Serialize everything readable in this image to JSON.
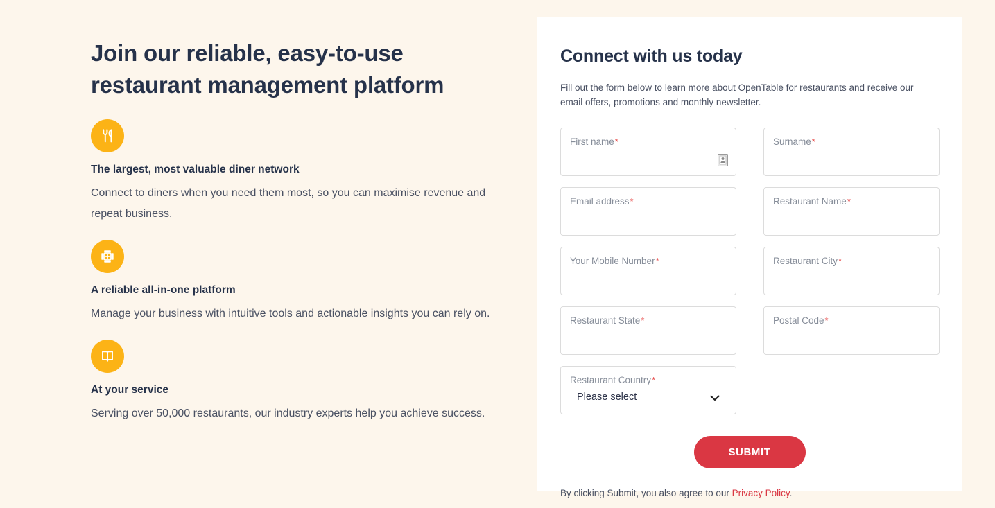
{
  "theme": {
    "page_background": "#fdf6ec",
    "panel_background": "#ffffff",
    "accent_amber": "#fcb316",
    "accent_red": "#da3743",
    "heading_color": "#26324a",
    "body_text_color": "#4a5163",
    "required_marker_color": "#e8504f",
    "field_border_color": "#dcdcdc"
  },
  "hero": {
    "title": "Join our reliable, easy-to-use restaurant management platform",
    "features": [
      {
        "icon": "fork-and-knife-icon",
        "title": "The largest, most valuable diner network",
        "description": "Connect to diners when you need them most, so you can maximise revenue and repeat business."
      },
      {
        "icon": "all-in-one-platform-icon",
        "title": "A reliable all-in-one platform",
        "description": "Manage your business with intuitive tools and actionable insights you can rely on."
      },
      {
        "icon": "open-book-icon",
        "title": "At your service",
        "description": "Serving over 50,000 restaurants, our industry experts help you achieve success."
      }
    ]
  },
  "form": {
    "title": "Connect with us today",
    "subtitle": "Fill out the form below to learn more about OpenTable for restaurants and receive our email offers, promotions and monthly newsletter.",
    "required_marker": "*",
    "fields": [
      {
        "name": "first-name",
        "label": "First name",
        "required": true,
        "value": "",
        "placeholder": "",
        "has_autofill_icon": true
      },
      {
        "name": "surname",
        "label": "Surname",
        "required": true,
        "value": "",
        "placeholder": "",
        "has_autofill_icon": false
      },
      {
        "name": "email-address",
        "label": "Email address",
        "required": true,
        "value": "",
        "placeholder": "",
        "has_autofill_icon": false
      },
      {
        "name": "restaurant-name",
        "label": "Restaurant Name",
        "required": true,
        "value": "",
        "placeholder": "",
        "has_autofill_icon": false
      },
      {
        "name": "mobile-number",
        "label": "Your Mobile Number",
        "required": true,
        "value": "",
        "placeholder": "",
        "has_autofill_icon": false
      },
      {
        "name": "restaurant-city",
        "label": "Restaurant City",
        "required": true,
        "value": "",
        "placeholder": "",
        "has_autofill_icon": false
      },
      {
        "name": "restaurant-state",
        "label": "Restaurant State",
        "required": true,
        "value": "",
        "placeholder": "",
        "has_autofill_icon": false
      },
      {
        "name": "postal-code",
        "label": "Postal Code",
        "required": true,
        "value": "",
        "placeholder": "",
        "has_autofill_icon": false
      }
    ],
    "country_select": {
      "name": "restaurant-country",
      "label": "Restaurant Country",
      "required": true,
      "selected": "Please select"
    },
    "submit_label": "SUBMIT",
    "legal_prefix": "By clicking Submit, you also agree to our ",
    "legal_link": "Privacy Policy",
    "legal_suffix": "."
  }
}
